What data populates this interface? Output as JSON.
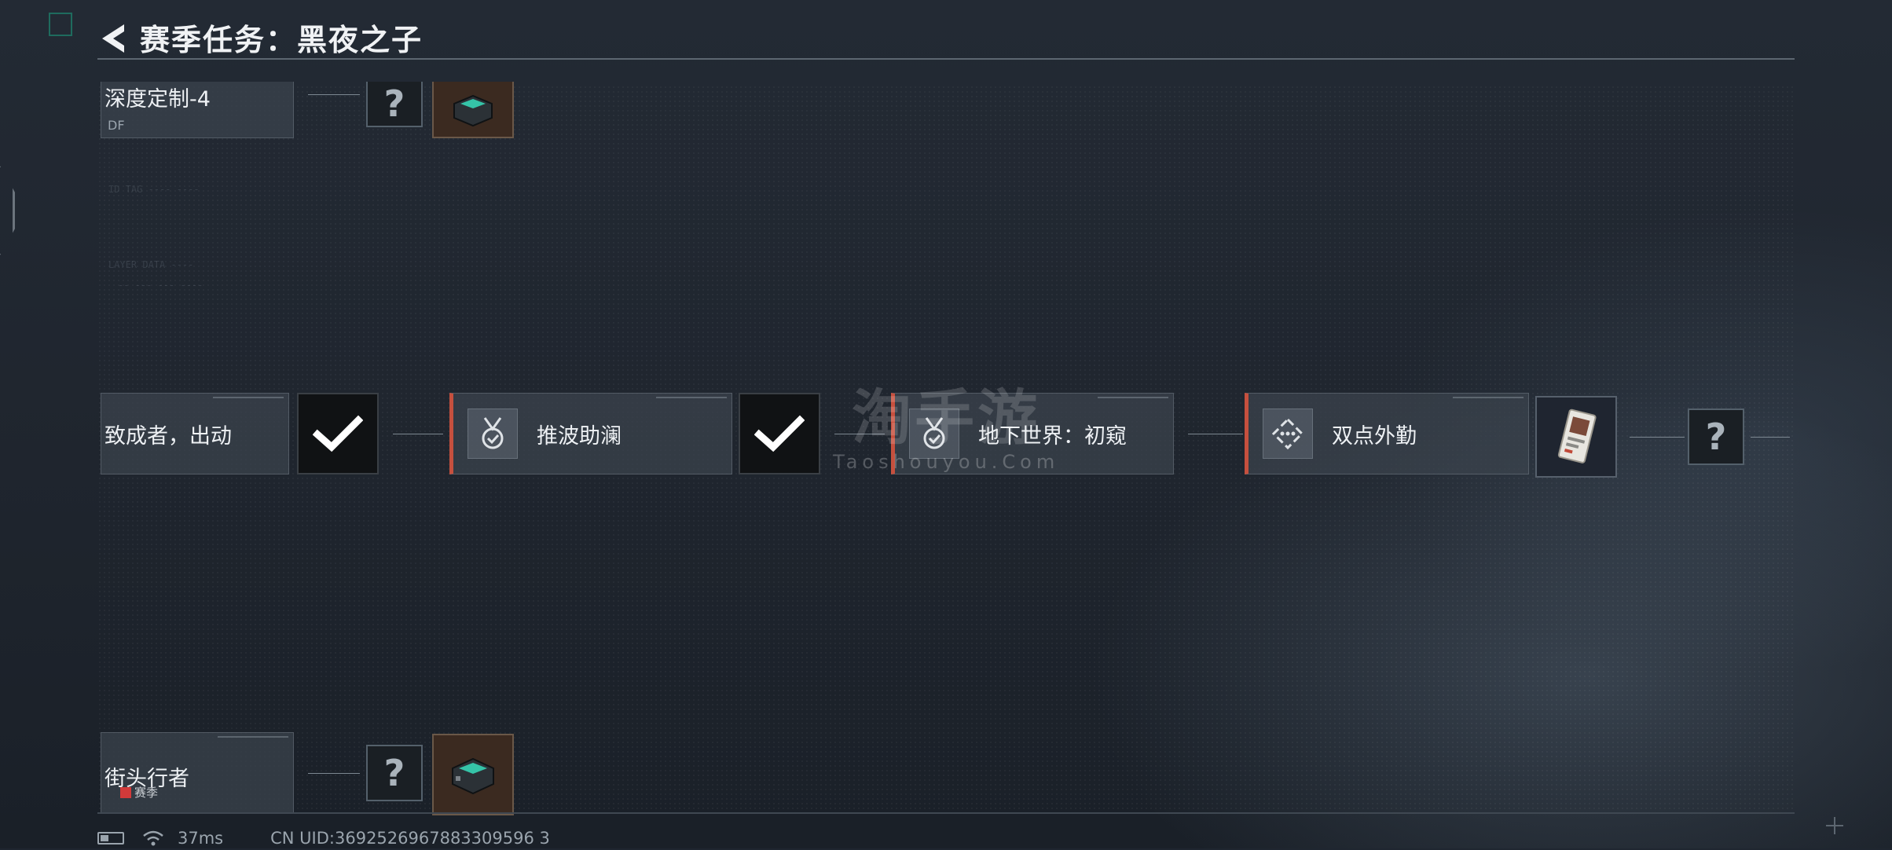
{
  "header": {
    "title": "赛季任务：黑夜之子"
  },
  "top_node": {
    "label": "深度定制-4",
    "sub": "DF"
  },
  "bottom_node": {
    "label": "街头行者",
    "badge": "赛季"
  },
  "row": {
    "node1": {
      "label": "致成者，出动"
    },
    "node2": {
      "label": "推波助澜"
    },
    "node3": {
      "label": "地下世界：初窥"
    },
    "node4": {
      "label": "双点外勤"
    }
  },
  "question_mark": "?",
  "watermark": {
    "cn": "淘手游",
    "en": "Taoshouyou.Com"
  },
  "status": {
    "ping": "37ms",
    "uid": "CN UID:3692526967883309596 3"
  },
  "colors": {
    "accent_red": "#c6503e",
    "check_white": "#ffffff",
    "corner_green": "#1e6b5e"
  }
}
